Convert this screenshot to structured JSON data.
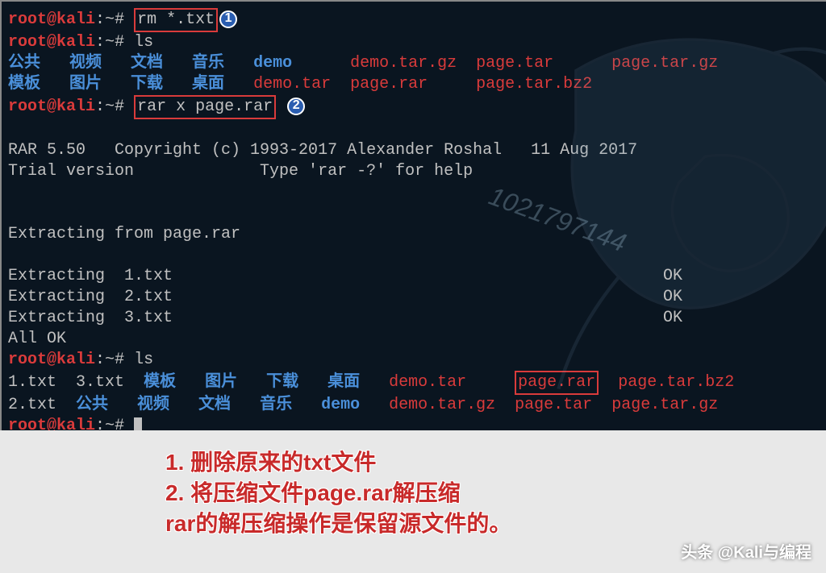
{
  "prompt": {
    "user": "root@kali",
    "sep": ":",
    "path": "~",
    "hash": "#"
  },
  "cmd": {
    "rm": "rm *.txt",
    "ls": "ls",
    "rarx": "rar x page.rar"
  },
  "badge": {
    "one": "1",
    "two": "2"
  },
  "ls1": {
    "r1c1": "公共",
    "r1c2": "视频",
    "r1c3": "文档",
    "r1c4": "音乐",
    "r1c5": "demo",
    "r1c6": "demo.tar.gz",
    "r1c7": "page.tar",
    "r1c8": "page.tar.gz",
    "r2c1": "模板",
    "r2c2": "图片",
    "r2c3": "下载",
    "r2c4": "桌面",
    "r2c5": "demo.tar",
    "r2c6": "page.rar",
    "r2c7": "page.tar.bz2"
  },
  "rar": {
    "copy": "RAR 5.50   Copyright (c) 1993-2017 Alexander Roshal   11 Aug 2017",
    "trial": "Trial version             Type 'rar -?' for help",
    "from": "Extracting from page.rar",
    "e1l": "Extracting  1.txt",
    "e2l": "Extracting  2.txt",
    "e3l": "Extracting  3.txt",
    "ok": "OK",
    "allok": "All OK"
  },
  "ls2": {
    "r1c1": "1.txt",
    "r1c2": "3.txt",
    "r1c3": "模板",
    "r1c4": "图片",
    "r1c5": "下载",
    "r1c6": "桌面",
    "r1c7": "demo.tar",
    "r1c8": "page.rar",
    "r1c9": "page.tar.bz2",
    "r2c1": "2.txt",
    "r2c2": "公共",
    "r2c3": "视频",
    "r2c4": "文档",
    "r2c5": "音乐",
    "r2c6": "demo",
    "r2c7": "demo.tar.gz",
    "r2c8": "page.tar",
    "r2c9": "page.tar.gz"
  },
  "annot": {
    "l1a": "1. 删除原来的",
    "l1b": "txt",
    "l1c": "文件",
    "l2a": "2. 将压缩文件",
    "l2b": "page.rar",
    "l2c": "解压缩",
    "l3a": "rar",
    "l3b": "的解压缩操作是保留源文件的。"
  },
  "wm": {
    "diag": "1021797144",
    "bottom": "头条 @Kali与编程"
  }
}
